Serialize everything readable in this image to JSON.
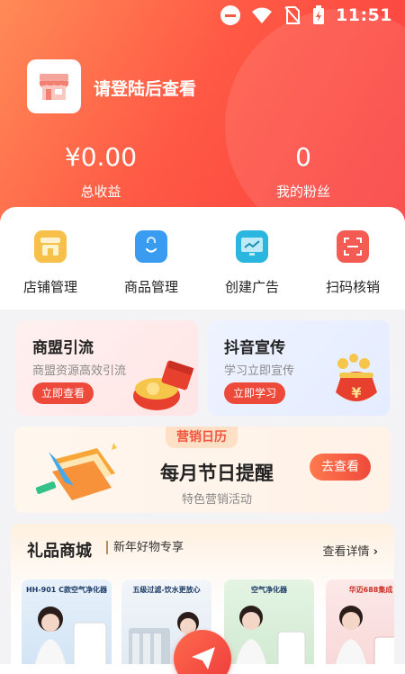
{
  "status": {
    "time": "11:51"
  },
  "profile": {
    "login_prompt": "请登陆后查看"
  },
  "stats": [
    {
      "value": "¥0.00",
      "label": "总收益"
    },
    {
      "value": "0",
      "label": "我的粉丝"
    }
  ],
  "quick_actions": [
    {
      "label": "店铺管理",
      "icon": "store-icon",
      "color": "#f5b83a"
    },
    {
      "label": "商品管理",
      "icon": "shopping-bag-icon",
      "color": "#3a9cf1"
    },
    {
      "label": "创建广告",
      "icon": "chart-screen-icon",
      "color": "#2bb6e0"
    },
    {
      "label": "扫码核销",
      "icon": "scan-icon",
      "color": "#f35b53"
    }
  ],
  "promos": [
    {
      "title": "商盟引流",
      "subtitle": "商盟资源高效引流",
      "button": "立即查看"
    },
    {
      "title": "抖音宣传",
      "subtitle": "学习立即宣传",
      "button": "立即学习"
    }
  ],
  "calendar": {
    "tag": "营销日历",
    "title": "每月节日提醒",
    "subtitle": "特色营销活动",
    "button": "去查看"
  },
  "mall": {
    "title": "礼品商城",
    "subtitle": "新年好物专享",
    "more": "查看详情",
    "products": [
      {
        "caption": "HH-901 C款空气净化器"
      },
      {
        "caption": "五级过滤-饮水更放心"
      },
      {
        "caption": "空气净化器"
      },
      {
        "caption": "华迈688集成"
      }
    ]
  },
  "colors": {
    "accent": "#f93d3f",
    "accent_light": "#ff8a57"
  }
}
